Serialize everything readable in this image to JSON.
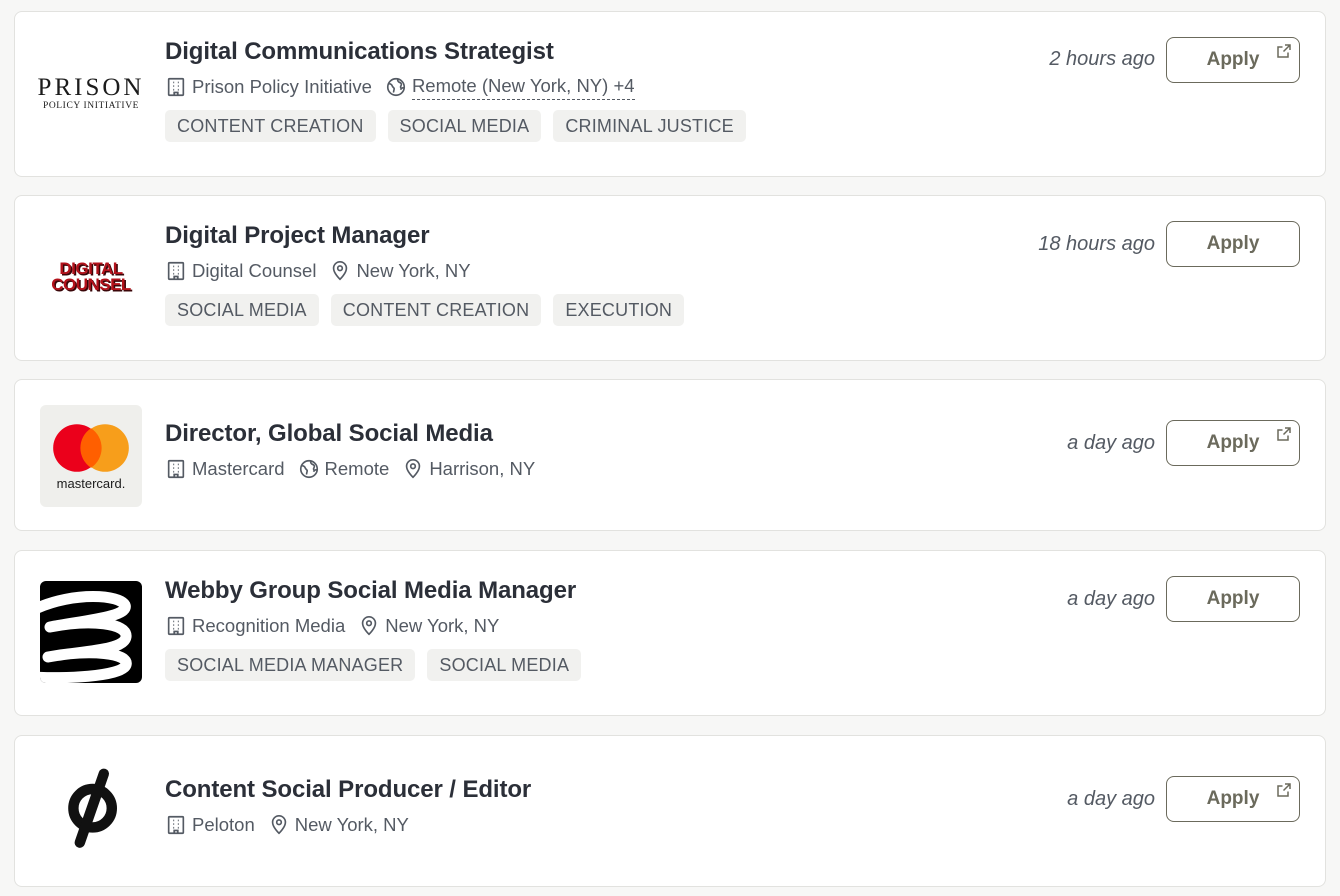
{
  "jobs": [
    {
      "logo": {
        "name": "prison-policy-initiative-logo",
        "line1": "PRISON",
        "line2": "POLICY INITIATIVE"
      },
      "title": "Digital Communications Strategist",
      "company": "Prison Policy Initiative",
      "remote": "Remote (New York, NY) +4",
      "location": "",
      "tags": [
        "CONTENT CREATION",
        "SOCIAL MEDIA",
        "CRIMINAL JUSTICE"
      ],
      "posted": "2 hours ago",
      "apply_label": "Apply",
      "external_icon": "external-link-icon"
    },
    {
      "logo": {
        "name": "digital-counsel-logo",
        "line1": "DIGITAL",
        "line2": "COUNSEL"
      },
      "title": "Digital Project Manager",
      "company": "Digital Counsel",
      "remote": "",
      "location": "New York, NY",
      "tags": [
        "SOCIAL MEDIA",
        "CONTENT CREATION",
        "EXECUTION"
      ],
      "posted": "18 hours ago",
      "apply_label": "Apply"
    },
    {
      "logo": {
        "name": "mastercard-logo",
        "line1": "mastercard."
      },
      "title": "Director, Global Social Media",
      "company": "Mastercard",
      "remote": "Remote",
      "location": "Harrison, NY",
      "tags": [],
      "posted": "a day ago",
      "apply_label": "Apply",
      "external_icon": "external-link-icon"
    },
    {
      "logo": {
        "name": "webby-group-logo"
      },
      "title": "Webby Group Social Media Manager",
      "company": "Recognition Media",
      "remote": "",
      "location": "New York, NY",
      "tags": [
        "SOCIAL MEDIA MANAGER",
        "SOCIAL MEDIA"
      ],
      "posted": "a day ago",
      "apply_label": "Apply"
    },
    {
      "logo": {
        "name": "peloton-logo"
      },
      "title": "Content Social Producer / Editor",
      "company": "Peloton",
      "remote": "",
      "location": "New York, NY",
      "tags": [],
      "posted": "a day ago",
      "apply_label": "Apply",
      "external_icon": "external-link-icon"
    }
  ],
  "icons": {
    "company": "building-icon",
    "remote": "globe-icon",
    "location": "map-pin-icon"
  },
  "colors": {
    "title": "#2b2f38",
    "meta": "#545a63",
    "tag_bg": "#f1f1ef",
    "apply_border": "#6b6a5c",
    "mastercard_red": "#eb001b",
    "mastercard_orange": "#f79e1b",
    "digital_counsel_red": "#b3121b"
  }
}
